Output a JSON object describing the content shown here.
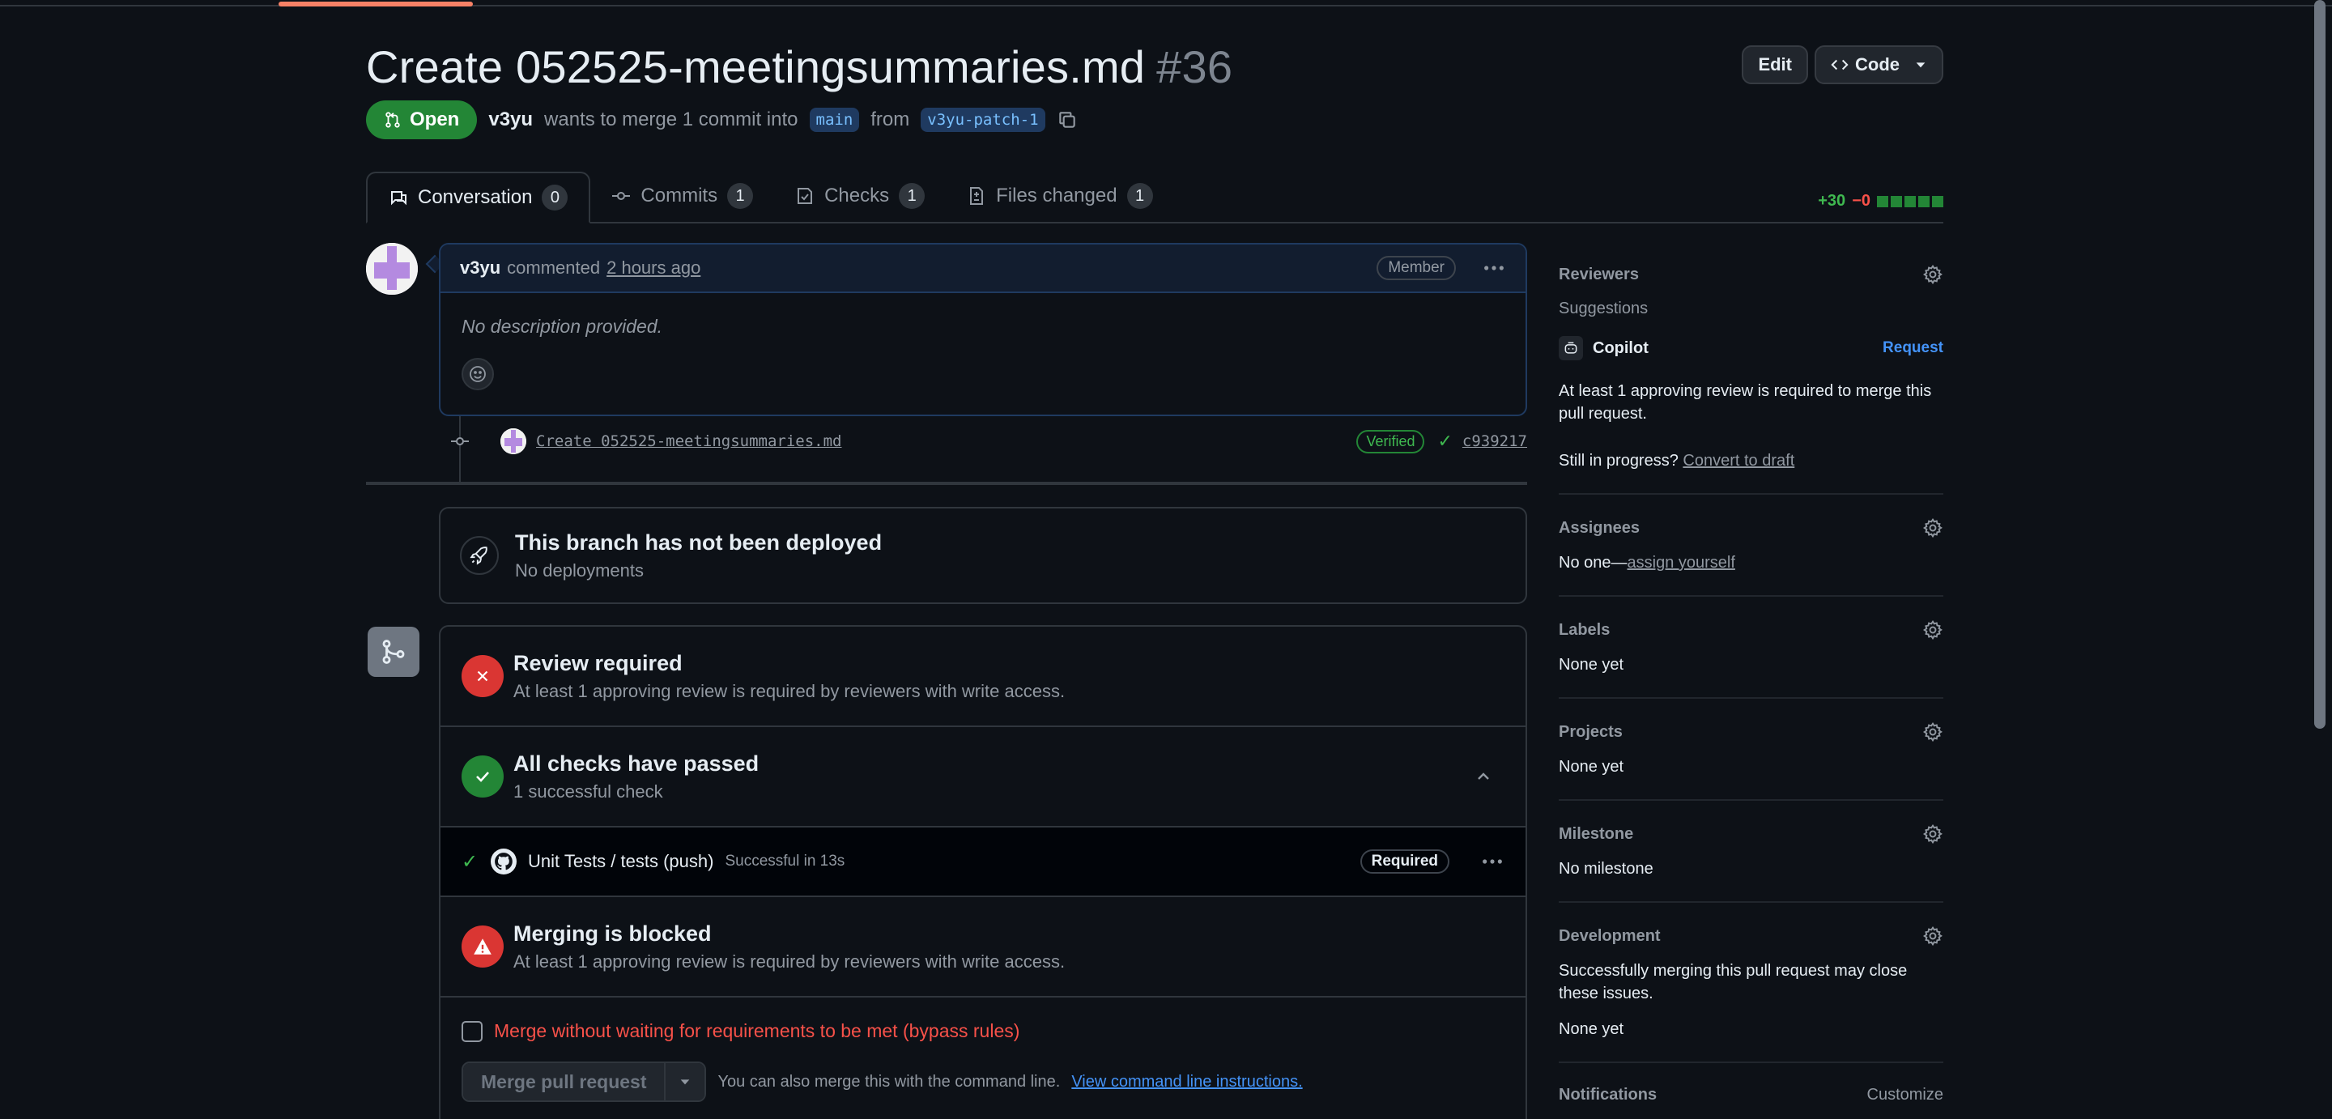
{
  "pr": {
    "title": "Create 052525-meetingsummaries.md",
    "number": "#36",
    "state": "Open",
    "author": "v3yu",
    "merge_text": "wants to merge 1 commit into",
    "base_branch": "main",
    "from_text": "from",
    "head_branch": "v3yu-patch-1"
  },
  "header": {
    "edit_label": "Edit",
    "code_label": "Code"
  },
  "tabs": [
    {
      "label": "Conversation",
      "count": "0"
    },
    {
      "label": "Commits",
      "count": "1"
    },
    {
      "label": "Checks",
      "count": "1"
    },
    {
      "label": "Files changed",
      "count": "1"
    }
  ],
  "diffstat": {
    "additions": "+30",
    "deletions": "−0"
  },
  "comment": {
    "author": "v3yu",
    "action": "commented",
    "time": "2 hours ago",
    "role_badge": "Member",
    "body": "No description provided."
  },
  "commit": {
    "message": "Create 052525-meetingsummaries.md",
    "verified": "Verified",
    "sha": "c939217"
  },
  "deployment": {
    "title": "This branch has not been deployed",
    "subtitle": "No deployments"
  },
  "merge": {
    "review_title": "Review required",
    "review_sub": "At least 1 approving review is required by reviewers with write access.",
    "checks_title": "All checks have passed",
    "checks_sub": "1 successful check",
    "check_name": "Unit Tests / tests (push)",
    "check_duration": "Successful in 13s",
    "check_badge": "Required",
    "blocked_title": "Merging is blocked",
    "blocked_sub": "At least 1 approving review is required by reviewers with write access.",
    "bypass_label": "Merge without waiting for requirements to be met (bypass rules)",
    "merge_button": "Merge pull request",
    "cli_text": "You can also merge this with the command line.",
    "cli_link": "View command line instructions."
  },
  "sidebar": {
    "reviewers_label": "Reviewers",
    "suggestions_label": "Suggestions",
    "copilot_label": "Copilot",
    "request_label": "Request",
    "review_note": "At least 1 approving review is required to merge this pull request.",
    "progress_text": "Still in progress?",
    "draft_link": "Convert to draft",
    "assignees_label": "Assignees",
    "assignees_none": "No one—",
    "assign_link": "assign yourself",
    "labels_label": "Labels",
    "labels_value": "None yet",
    "projects_label": "Projects",
    "projects_value": "None yet",
    "milestone_label": "Milestone",
    "milestone_value": "No milestone",
    "development_label": "Development",
    "development_note": "Successfully merging this pull request may close these issues.",
    "development_value": "None yet",
    "notifications_label": "Notifications",
    "customize_label": "Customize"
  },
  "colors": {
    "background": "#0d1117",
    "open_green": "#238636",
    "danger_red": "#da3633",
    "link_blue": "#4493f8"
  },
  "icons": [
    "pull-request-icon",
    "copy-icon",
    "code-icon",
    "comment-icon",
    "commit-icon",
    "checks-icon",
    "file-diff-icon",
    "kebab-icon",
    "smiley-icon",
    "rocket-icon",
    "git-merge-icon",
    "x-icon",
    "check-icon",
    "chevron-up-icon",
    "github-icon",
    "alert-icon",
    "gear-icon",
    "copilot-icon",
    "triangle-down-icon"
  ]
}
